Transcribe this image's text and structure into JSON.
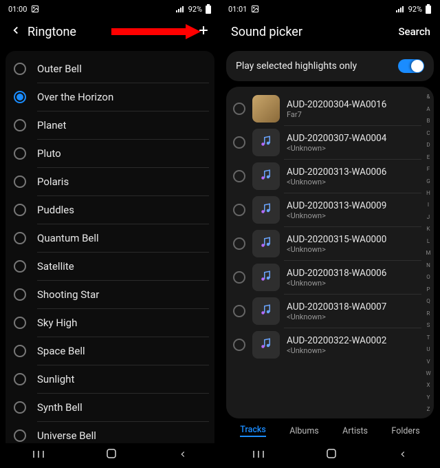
{
  "left": {
    "status": {
      "time": "01:00",
      "battery": "92%"
    },
    "header": {
      "title": "Ringtone"
    },
    "ringtones": [
      {
        "label": "Outer Bell",
        "selected": false
      },
      {
        "label": "Over the Horizon",
        "selected": true
      },
      {
        "label": "Planet",
        "selected": false
      },
      {
        "label": "Pluto",
        "selected": false
      },
      {
        "label": "Polaris",
        "selected": false
      },
      {
        "label": "Puddles",
        "selected": false
      },
      {
        "label": "Quantum Bell",
        "selected": false
      },
      {
        "label": "Satellite",
        "selected": false
      },
      {
        "label": "Shooting Star",
        "selected": false
      },
      {
        "label": "Sky High",
        "selected": false
      },
      {
        "label": "Space Bell",
        "selected": false
      },
      {
        "label": "Sunlight",
        "selected": false
      },
      {
        "label": "Synth Bell",
        "selected": false
      },
      {
        "label": "Universe Bell",
        "selected": false
      }
    ]
  },
  "right": {
    "status": {
      "time": "01:01",
      "battery": "92%"
    },
    "header": {
      "title": "Sound picker",
      "search_label": "Search"
    },
    "highlights": {
      "label": "Play selected highlights only",
      "enabled": true
    },
    "tracks": [
      {
        "title": "AUD-20200304-WA0016",
        "sub": "Far7",
        "thumb": "img"
      },
      {
        "title": "AUD-20200307-WA0004",
        "sub": "<Unknown>",
        "thumb": "note"
      },
      {
        "title": "AUD-20200313-WA0006",
        "sub": "<Unknown>",
        "thumb": "note"
      },
      {
        "title": "AUD-20200313-WA0009",
        "sub": "<Unknown>",
        "thumb": "note"
      },
      {
        "title": "AUD-20200315-WA0000",
        "sub": "<Unknown>",
        "thumb": "note"
      },
      {
        "title": "AUD-20200318-WA0006",
        "sub": "<Unknown>",
        "thumb": "note"
      },
      {
        "title": "AUD-20200318-WA0007",
        "sub": "<Unknown>",
        "thumb": "note"
      },
      {
        "title": "AUD-20200322-WA0002",
        "sub": "<Unknown>",
        "thumb": "note"
      }
    ],
    "index": [
      "&",
      "A",
      "B",
      "C",
      "D",
      "E",
      "F",
      "G",
      "H",
      "I",
      "J",
      "K",
      "L",
      "M",
      "N",
      "O",
      "P",
      "Q",
      "R",
      "S",
      "T",
      "U",
      "V",
      "W",
      "X",
      "Y",
      "Z"
    ],
    "tabs": [
      {
        "label": "Tracks",
        "active": true
      },
      {
        "label": "Albums",
        "active": false
      },
      {
        "label": "Artists",
        "active": false
      },
      {
        "label": "Folders",
        "active": false
      }
    ]
  }
}
